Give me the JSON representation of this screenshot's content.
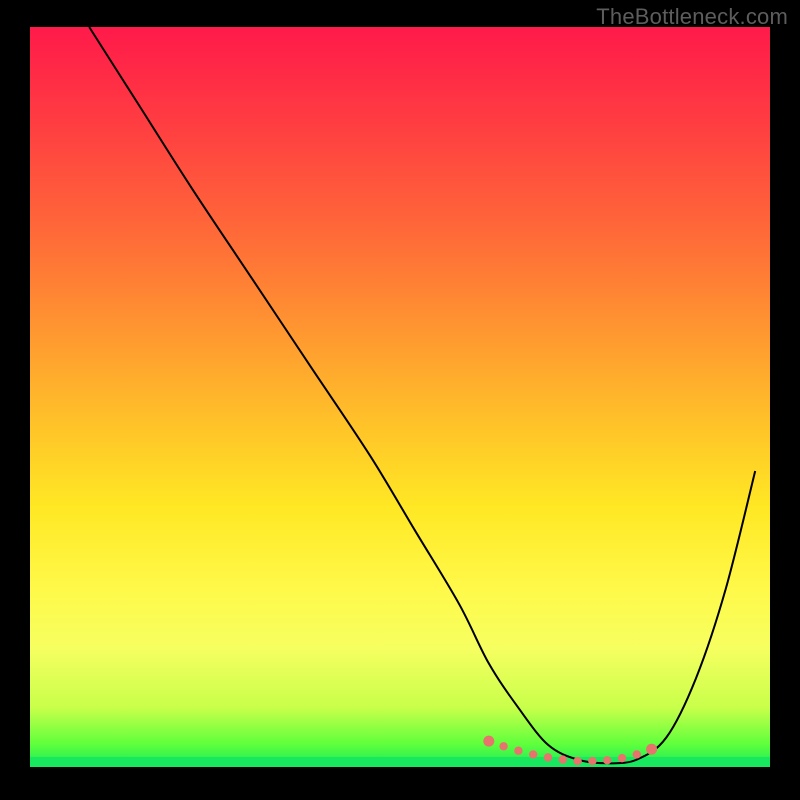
{
  "watermark": "TheBottleneck.com",
  "chart_data": {
    "type": "line",
    "title": "",
    "xlabel": "",
    "ylabel": "",
    "xlim": [
      0,
      100
    ],
    "ylim": [
      0,
      100
    ],
    "series": [
      {
        "name": "bottleneck-curve",
        "x": [
          8,
          15,
          22,
          30,
          38,
          46,
          52,
          58,
          62,
          66,
          70,
          74,
          78,
          82,
          86,
          90,
          94,
          98
        ],
        "y": [
          100,
          89,
          78,
          66,
          54,
          42,
          32,
          22,
          14,
          8,
          3,
          1,
          0.5,
          1,
          4,
          12,
          24,
          40
        ]
      }
    ],
    "highlight_points": {
      "name": "minimum-region",
      "x": [
        62,
        64,
        66,
        68,
        70,
        72,
        74,
        76,
        78,
        80,
        82,
        84
      ],
      "y": [
        3.5,
        2.8,
        2.2,
        1.7,
        1.3,
        1.0,
        0.8,
        0.8,
        0.9,
        1.2,
        1.7,
        2.4
      ]
    },
    "colors": {
      "gradient_top": "#ff1a4a",
      "gradient_bottom": "#17e85e",
      "curve": "#000000",
      "dots": "#e6746d"
    }
  }
}
